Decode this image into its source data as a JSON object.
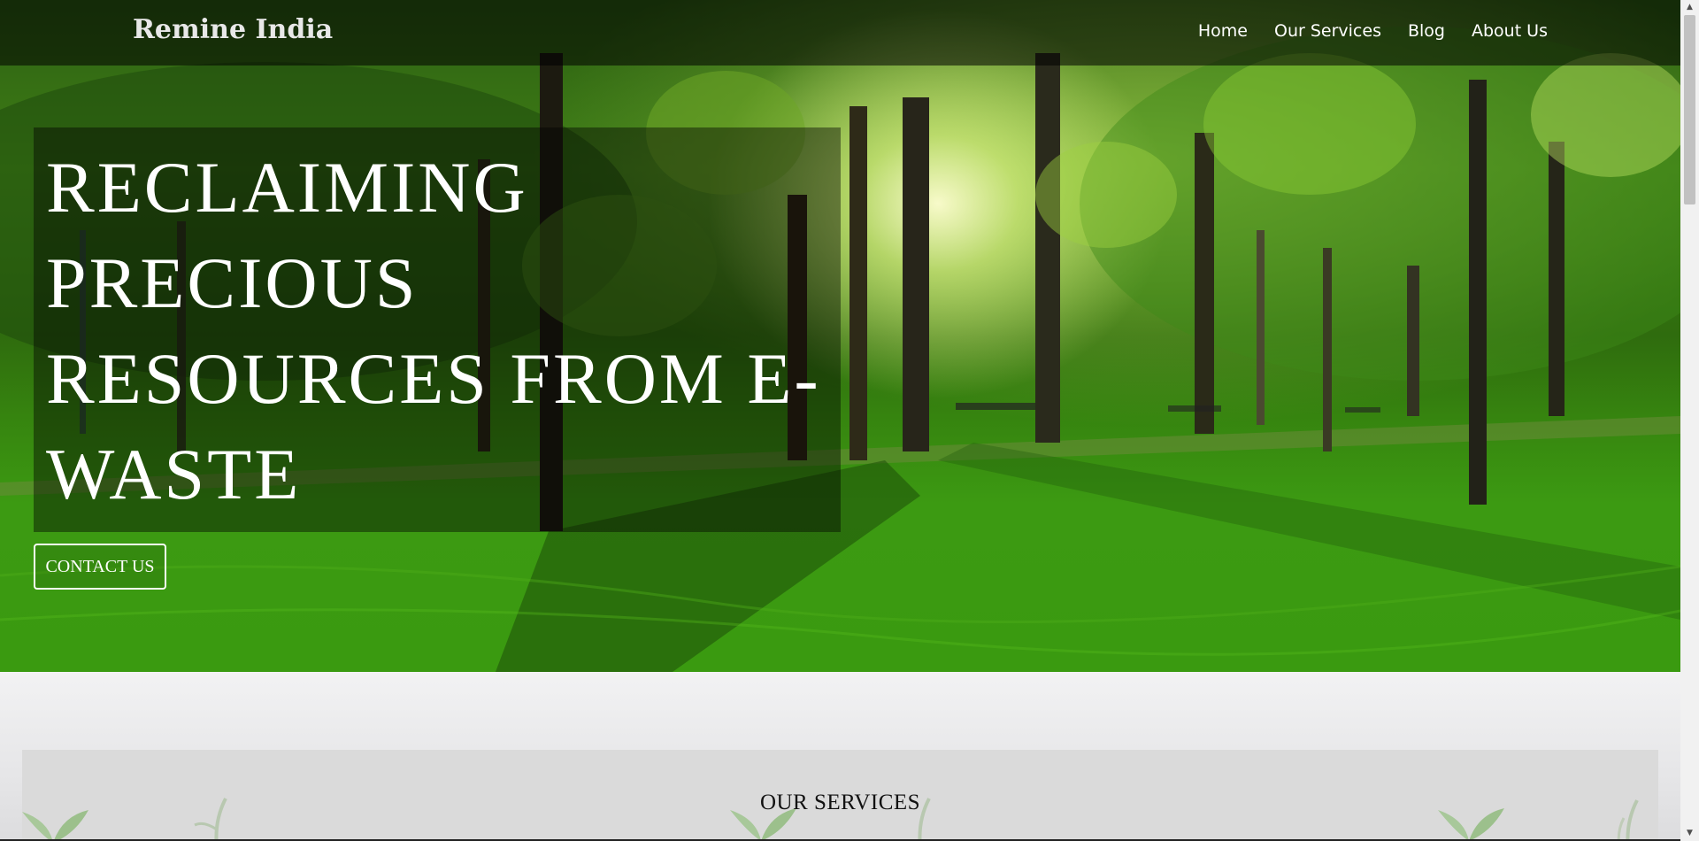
{
  "brand": {
    "name": "Remine India"
  },
  "nav": {
    "links": [
      {
        "label": "Home"
      },
      {
        "label": "Our Services"
      },
      {
        "label": "Blog"
      },
      {
        "label": "About Us"
      }
    ]
  },
  "hero": {
    "headline": "RECLAIMING PRECIOUS RESOURCES FROM E-WASTE",
    "cta_label": "CONTACT US",
    "background": "green-forest-park-image"
  },
  "services": {
    "title": "OUR SERVICES"
  },
  "colors": {
    "nav_background": "#000000",
    "text_light": "#ffffff",
    "panel_background": "#dadada"
  }
}
